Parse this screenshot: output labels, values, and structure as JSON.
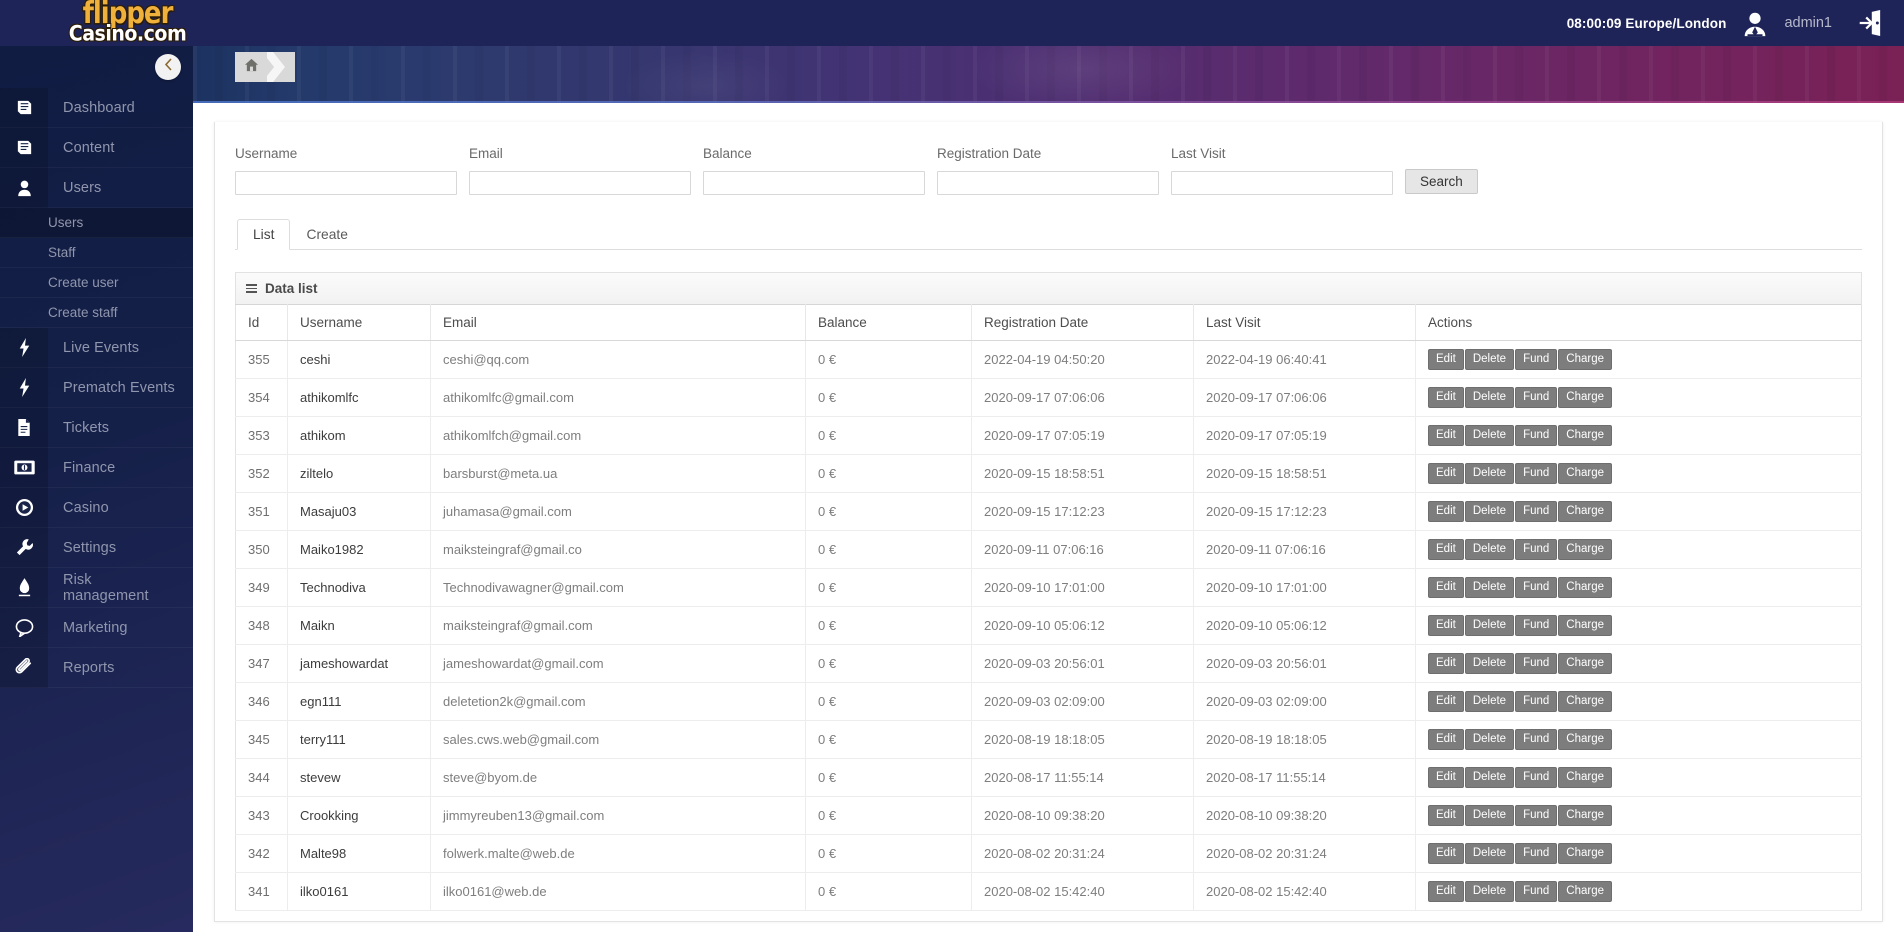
{
  "brand": {
    "line1": "flipper",
    "line2": "Casino.com",
    "accent_color": "#f0b03c"
  },
  "topbar": {
    "clock": "08:00:09 Europe/London",
    "user": "admin1",
    "avatar_icon": "user-avatar-icon",
    "logout_icon": "logout-door-icon"
  },
  "breadcrumb": {
    "home_icon": "home-icon",
    "collapse_icon": "chevron-left-icon"
  },
  "sidebar": {
    "items": [
      {
        "label": "Dashboard",
        "icon": "book-icon",
        "has_caret": true
      },
      {
        "label": "Content",
        "icon": "book-icon",
        "has_caret": true
      },
      {
        "label": "Users",
        "icon": "user-icon",
        "has_caret": true
      },
      {
        "label": "Live Events",
        "icon": "bolt-icon",
        "has_caret": true
      },
      {
        "label": "Prematch Events",
        "icon": "bolt-icon",
        "has_caret": true
      },
      {
        "label": "Tickets",
        "icon": "document-icon",
        "has_caret": true
      },
      {
        "label": "Finance",
        "icon": "banknote-icon",
        "has_caret": true
      },
      {
        "label": "Casino",
        "icon": "play-circle-icon",
        "has_caret": true
      },
      {
        "label": "Settings",
        "icon": "wrench-icon",
        "has_caret": true
      },
      {
        "label": "Risk management",
        "icon": "flame-icon",
        "has_caret": true
      },
      {
        "label": "Marketing",
        "icon": "speech-bubble-icon",
        "has_caret": true
      },
      {
        "label": "Reports",
        "icon": "paperclip-icon",
        "has_caret": true
      }
    ],
    "submenu": [
      {
        "label": "Users",
        "active": true
      },
      {
        "label": "Staff",
        "active": false
      },
      {
        "label": "Create user",
        "active": false
      },
      {
        "label": "Create staff",
        "active": false
      }
    ]
  },
  "search": {
    "fields": [
      {
        "label": "Username",
        "value": "",
        "placeholder": ""
      },
      {
        "label": "Email",
        "value": "",
        "placeholder": ""
      },
      {
        "label": "Balance",
        "value": "",
        "placeholder": ""
      },
      {
        "label": "Registration Date",
        "value": "",
        "placeholder": ""
      },
      {
        "label": "Last Visit",
        "value": "",
        "placeholder": ""
      }
    ],
    "button_label": "Search"
  },
  "tabs": [
    {
      "label": "List",
      "active": true
    },
    {
      "label": "Create",
      "active": false
    }
  ],
  "data_list": {
    "title": "Data list",
    "icon": "hamburger-icon",
    "columns": [
      "Id",
      "Username",
      "Email",
      "Balance",
      "Registration Date",
      "Last Visit",
      "Actions"
    ],
    "action_labels": [
      "Edit",
      "Delete",
      "Fund",
      "Charge"
    ],
    "rows": [
      {
        "id": "355",
        "username": "ceshi",
        "email": "ceshi@qq.com",
        "balance": "0 €",
        "registration": "2022-04-19 04:50:20",
        "last_visit": "2022-04-19 06:40:41"
      },
      {
        "id": "354",
        "username": "athikomlfc",
        "email": "athikomlfc@gmail.com",
        "balance": "0 €",
        "registration": "2020-09-17 07:06:06",
        "last_visit": "2020-09-17 07:06:06"
      },
      {
        "id": "353",
        "username": "athikom",
        "email": "athikomlfch@gmail.com",
        "balance": "0 €",
        "registration": "2020-09-17 07:05:19",
        "last_visit": "2020-09-17 07:05:19"
      },
      {
        "id": "352",
        "username": "ziltelo",
        "email": "barsburst@meta.ua",
        "balance": "0 €",
        "registration": "2020-09-15 18:58:51",
        "last_visit": "2020-09-15 18:58:51"
      },
      {
        "id": "351",
        "username": "Masaju03",
        "email": "juhamasa@gmail.com",
        "balance": "0 €",
        "registration": "2020-09-15 17:12:23",
        "last_visit": "2020-09-15 17:12:23"
      },
      {
        "id": "350",
        "username": "Maiko1982",
        "email": "maiksteingraf@gmail.co",
        "balance": "0 €",
        "registration": "2020-09-11 07:06:16",
        "last_visit": "2020-09-11 07:06:16"
      },
      {
        "id": "349",
        "username": "Technodiva",
        "email": "Technodivawagner@gmail.com",
        "balance": "0 €",
        "registration": "2020-09-10 17:01:00",
        "last_visit": "2020-09-10 17:01:00"
      },
      {
        "id": "348",
        "username": "Maikn",
        "email": "maiksteingraf@gmail.com",
        "balance": "0 €",
        "registration": "2020-09-10 05:06:12",
        "last_visit": "2020-09-10 05:06:12"
      },
      {
        "id": "347",
        "username": "jameshowardat",
        "email": "jameshowardat@gmail.com",
        "balance": "0 €",
        "registration": "2020-09-03 20:56:01",
        "last_visit": "2020-09-03 20:56:01"
      },
      {
        "id": "346",
        "username": "egn111",
        "email": "deletetion2k@gmail.com",
        "balance": "0 €",
        "registration": "2020-09-03 02:09:00",
        "last_visit": "2020-09-03 02:09:00"
      },
      {
        "id": "345",
        "username": "terry111",
        "email": "sales.cws.web@gmail.com",
        "balance": "0 €",
        "registration": "2020-08-19 18:18:05",
        "last_visit": "2020-08-19 18:18:05"
      },
      {
        "id": "344",
        "username": "stevew",
        "email": "steve@byom.de",
        "balance": "0 €",
        "registration": "2020-08-17 11:55:14",
        "last_visit": "2020-08-17 11:55:14"
      },
      {
        "id": "343",
        "username": "Crookking",
        "email": "jimmyreuben13@gmail.com",
        "balance": "0 €",
        "registration": "2020-08-10 09:38:20",
        "last_visit": "2020-08-10 09:38:20"
      },
      {
        "id": "342",
        "username": "Malte98",
        "email": "folwerk.malte@web.de",
        "balance": "0 €",
        "registration": "2020-08-02 20:31:24",
        "last_visit": "2020-08-02 20:31:24"
      },
      {
        "id": "341",
        "username": "ilko0161",
        "email": "ilko0161@web.de",
        "balance": "0 €",
        "registration": "2020-08-02 15:42:40",
        "last_visit": "2020-08-02 15:42:40"
      }
    ]
  }
}
